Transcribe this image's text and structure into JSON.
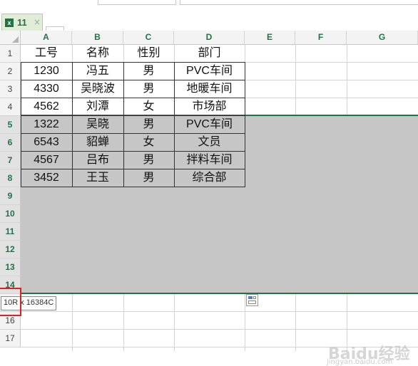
{
  "sheet_tab": {
    "name": "11",
    "file_badge": "x",
    "close": "×"
  },
  "columns": [
    "A",
    "B",
    "C",
    "D",
    "E",
    "F",
    "G"
  ],
  "rows": [
    "1",
    "2",
    "3",
    "4",
    "5",
    "6",
    "7",
    "8",
    "9",
    "10",
    "11",
    "12",
    "13",
    "14",
    "15",
    "16",
    "17"
  ],
  "table": {
    "headers": [
      "工号",
      "名称",
      "性别",
      "部门"
    ],
    "body": [
      [
        "1230",
        "冯五",
        "男",
        "PVC车间"
      ],
      [
        "4330",
        "吴晓波",
        "男",
        "地暖车间"
      ],
      [
        "4562",
        "刘潭",
        "女",
        "市场部"
      ],
      [
        "1322",
        "吴晓",
        "男",
        "PVC车间"
      ],
      [
        "6543",
        "貂蝉",
        "女",
        "文员"
      ],
      [
        "4567",
        "吕布",
        "男",
        "拌料车间"
      ],
      [
        "3452",
        "王玉",
        "男",
        "综合部"
      ]
    ]
  },
  "selection_tooltip": "10R x 16384C",
  "watermark": {
    "main": "Baidu经验",
    "sub": "jingyan.baidu.com"
  },
  "colors": {
    "accent": "#217346",
    "selection": "#c6c6c6",
    "highlight_frame": "#e02020"
  }
}
